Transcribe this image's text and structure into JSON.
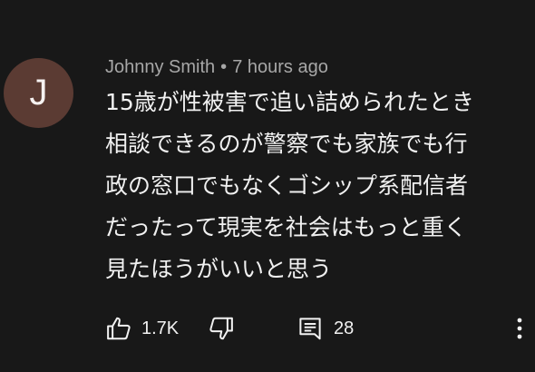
{
  "comment": {
    "avatar_letter": "J",
    "author": "Johnny Smith",
    "separator": "•",
    "timestamp": "7 hours ago",
    "text_lines": [
      "15歳が性被害で追い詰められたとき",
      "相談できるのが警察でも家族でも行",
      "政の窓口でもなくゴシップ系配信者",
      "だったって現実を社会はもっと重く",
      "見たほうがいいと思う"
    ]
  },
  "actions": {
    "like_count": "1.7K",
    "reply_count": "28"
  },
  "icons": {
    "like": "thumbs-up-icon",
    "dislike": "thumbs-down-icon",
    "replies": "comment-icon",
    "more": "more-vert-icon"
  },
  "colors": {
    "background": "#181818",
    "avatar": "#5b3b33",
    "meta_text": "#a7a7a7",
    "body_text": "#f1f1f1"
  }
}
